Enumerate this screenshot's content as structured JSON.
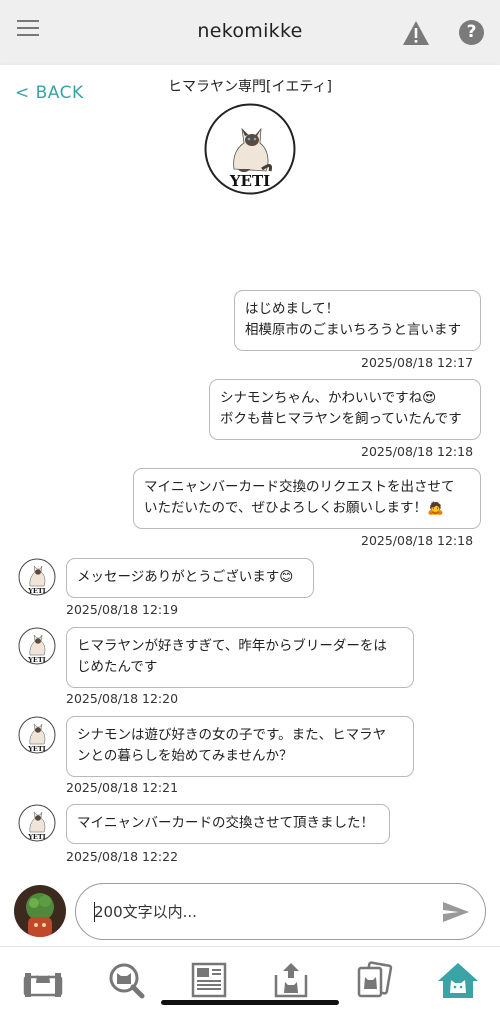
{
  "topbar": {
    "title": "nekomikke",
    "menu_icon": "hamburger-menu-icon",
    "warning_icon": "warning-triangle-icon",
    "help_icon": "help-circle-icon",
    "help_glyph": "?"
  },
  "header": {
    "back_label": "< BACK",
    "shop_name": "ヒマラヤン専門[イエティ]",
    "logo_text": "YETI"
  },
  "messages": [
    {
      "side": "right",
      "text": "はじめまして！\n相模原市のごまいちろうと言います",
      "time": "2025/08/18 12:17"
    },
    {
      "side": "right",
      "text": "シナモンちゃん、かわいいですね😍\nボクも昔ヒマラヤンを飼っていたんです",
      "time": "2025/08/18 12:18"
    },
    {
      "side": "right",
      "text": "マイニャンバーカード交換のリクエストを出させて\nいただいたので、ぜひよろしくお願いします！🙇",
      "time": "2025/08/18 12:18"
    },
    {
      "side": "left",
      "text": "メッセージありがとうございます😊",
      "time": "2025/08/18 12:19"
    },
    {
      "side": "left",
      "text": "ヒマラヤンが好きすぎて、昨年からブリーダーをは\nじめたんです",
      "time": "2025/08/18 12:20"
    },
    {
      "side": "left",
      "text": "シナモンは遊び好きの女の子です。また、ヒマラヤ\nンとの暮らしを始めてみませんか？",
      "time": "2025/08/18 12:21"
    },
    {
      "side": "left",
      "text": "マイニャンバーカードの交換させて頂きました！",
      "time": "2025/08/18 12:22"
    }
  ],
  "input": {
    "placeholder": "200文字以内...",
    "send_icon": "send-arrow-icon"
  },
  "bottom_nav": [
    {
      "name": "nav-cat-bed",
      "icon": "cat-bed-icon"
    },
    {
      "name": "nav-search",
      "icon": "cat-search-icon"
    },
    {
      "name": "nav-news",
      "icon": "newspaper-icon"
    },
    {
      "name": "nav-upload",
      "icon": "upload-cat-icon"
    },
    {
      "name": "nav-cards",
      "icon": "cat-cards-icon"
    },
    {
      "name": "nav-home",
      "icon": "cat-home-icon",
      "active": true
    }
  ],
  "colors": {
    "accent": "#3aa3a5",
    "topbar_bg": "#efefef",
    "bubble_border": "#b9b9b9",
    "icon_gray": "#7a7a7a"
  }
}
